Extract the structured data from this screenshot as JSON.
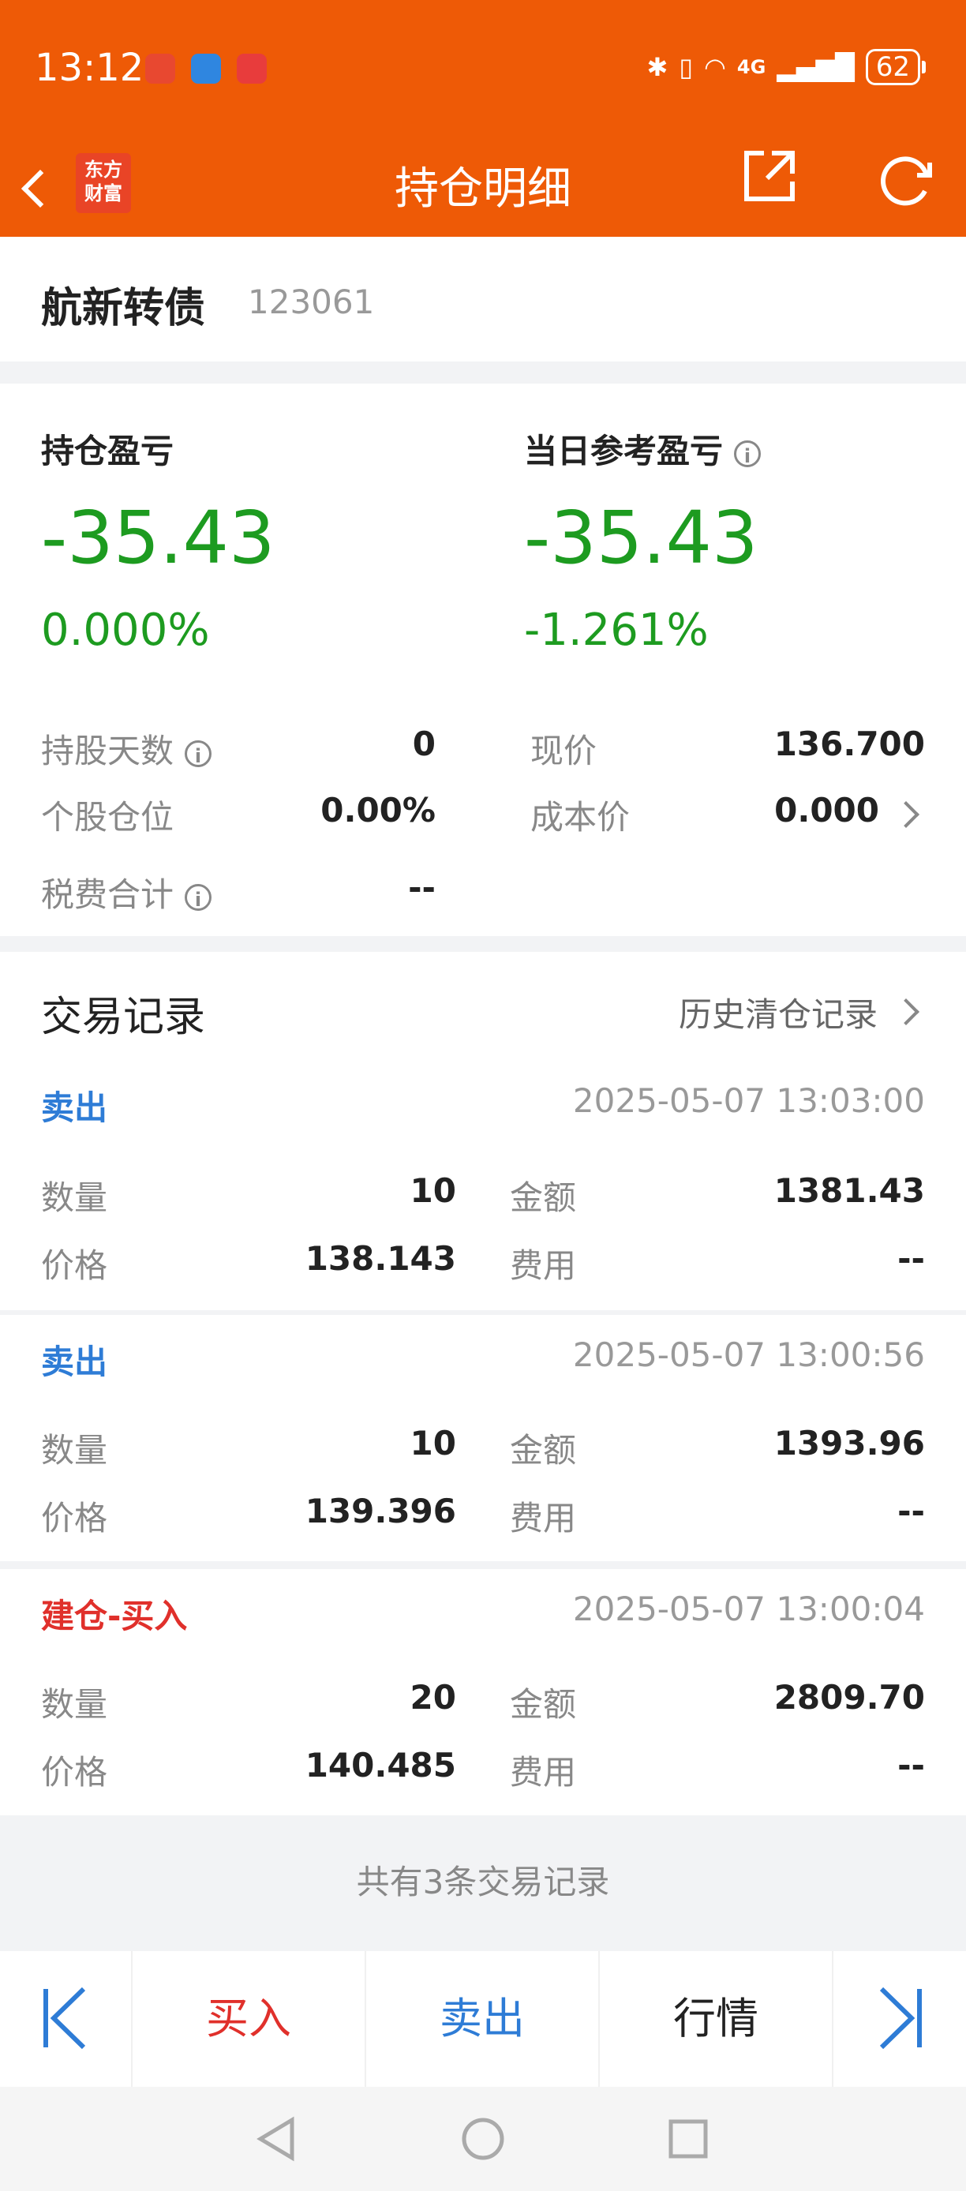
{
  "status_bar": {
    "time": "13:12",
    "network": "4G",
    "battery": "62"
  },
  "nav": {
    "title": "持仓明细",
    "logo_line1": "东方",
    "logo_line2": "财富"
  },
  "stock": {
    "name": "航新转债",
    "code": "123061"
  },
  "summary": {
    "position_pl_label": "持仓盈亏",
    "position_pl_value": "-35.43",
    "position_pl_pct": "0.000%",
    "daily_pl_label": "当日参考盈亏",
    "daily_pl_value": "-35.43",
    "daily_pl_pct": "-1.261%",
    "info_glyph": "i",
    "hold_days_label": "持股天数",
    "hold_days_value": "0",
    "position_ratio_label": "个股仓位",
    "position_ratio_value": "0.00%",
    "tax_fee_label": "税费合计",
    "tax_fee_value": "--",
    "current_price_label": "现价",
    "current_price_value": "136.700",
    "cost_price_label": "成本价",
    "cost_price_value": "0.000"
  },
  "trades": {
    "title": "交易记录",
    "history_link": "历史清仓记录",
    "labels": {
      "qty": "数量",
      "price": "价格",
      "amount": "金额",
      "fee": "费用"
    },
    "records": [
      {
        "type": "卖出",
        "time": "2025-05-07 13:03:00",
        "qty": "10",
        "price": "138.143",
        "amount": "1381.43",
        "fee": "--"
      },
      {
        "type": "卖出",
        "time": "2025-05-07 13:00:56",
        "qty": "10",
        "price": "139.396",
        "amount": "1393.96",
        "fee": "--"
      },
      {
        "type": "建仓-买入",
        "time": "2025-05-07 13:00:04",
        "qty": "20",
        "price": "140.485",
        "amount": "2809.70",
        "fee": "--"
      }
    ],
    "footer": "共有3条交易记录"
  },
  "tabbar": {
    "buy": "买入",
    "sell": "卖出",
    "quote": "行情"
  },
  "colors": {
    "brand": "#ee5a06",
    "loss": "#1d9b20",
    "sell": "#2e7cd6",
    "buy": "#e0302b"
  }
}
